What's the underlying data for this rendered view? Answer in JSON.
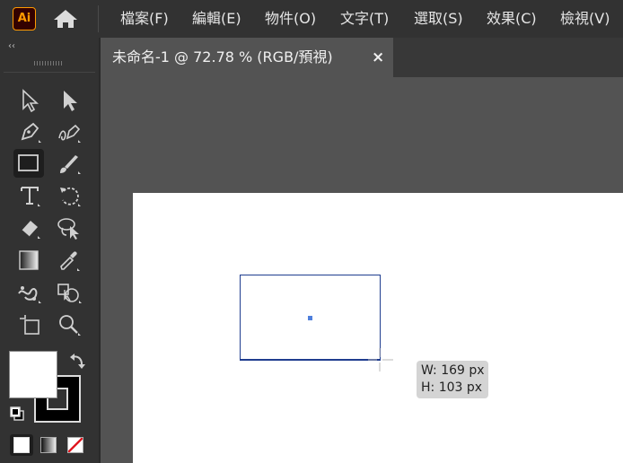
{
  "app": {
    "logo_text": "Ai",
    "accent": "#ff9a00"
  },
  "menu": [
    {
      "label": "檔案(F)"
    },
    {
      "label": "編輯(E)"
    },
    {
      "label": "物件(O)"
    },
    {
      "label": "文字(T)"
    },
    {
      "label": "選取(S)"
    },
    {
      "label": "效果(C)"
    },
    {
      "label": "檢視(V)"
    }
  ],
  "toolbar": {
    "collapse_glyph": "‹‹",
    "tools": [
      "selection-tool-icon",
      "direct-selection-tool-icon",
      "pen-tool-icon",
      "curvature-tool-icon",
      "rectangle-tool-icon",
      "paintbrush-tool-icon",
      "type-tool-icon",
      "rotate-tool-icon",
      "eraser-tool-icon",
      "lasso-tool-icon",
      "gradient-tool-icon",
      "eyedropper-tool-icon",
      "puppet-warp-tool-icon",
      "shape-builder-tool-icon",
      "artboard-tool-icon",
      "zoom-tool-icon"
    ],
    "active_tool": "rectangle-tool-icon",
    "fill_color": "#ffffff",
    "stroke_color": "#000000"
  },
  "document": {
    "tab_title": "未命名-1 @ 72.78 % (RGB/預視)",
    "close_glyph": "×"
  },
  "tooltip": {
    "width": "W: 169 px",
    "height": "H: 103 px"
  }
}
